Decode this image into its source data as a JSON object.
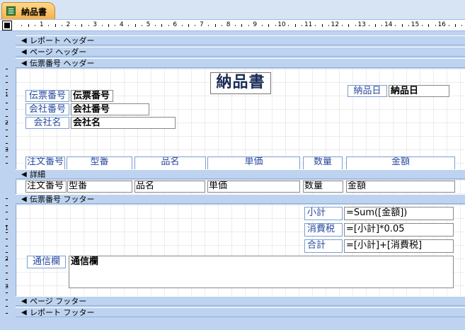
{
  "tab": {
    "label": "納品書",
    "icon": "report-icon"
  },
  "ruler": {
    "numbers": [
      "1",
      "2",
      "3",
      "4",
      "5",
      "6",
      "7",
      "8",
      "9",
      "10",
      "11",
      "12",
      "13",
      "14",
      "15",
      "16"
    ]
  },
  "gutter": {
    "page_header_numbers": [
      "1",
      "2",
      "3"
    ],
    "footer_numbers": [
      "1",
      "2",
      "3"
    ]
  },
  "sections": {
    "report_header": "レポート ヘッダー",
    "page_header": "ページ ヘッダー",
    "group_header": "伝票番号 ヘッダー",
    "detail": "詳細",
    "group_footer": "伝票番号 フッター",
    "page_footer": "ページ フッター",
    "report_footer": "レポート フッター"
  },
  "header": {
    "title": "納品書",
    "slip_no_label": "伝票番号",
    "slip_no_field": "伝票番号",
    "company_no_label": "会社番号",
    "company_no_field": "会社番号",
    "company_name_label": "会社名",
    "company_name_field": "会社名",
    "delivery_date_label": "納品日",
    "delivery_date_field": "納品日",
    "columns": [
      "注文番号",
      "型番",
      "品名",
      "単価",
      "数量",
      "金額"
    ]
  },
  "detail": {
    "fields": [
      "注文番号",
      "型番",
      "品名",
      "単価",
      "数量",
      "金額"
    ]
  },
  "footer": {
    "subtotal_label": "小計",
    "subtotal_expr": "=Sum([金額])",
    "tax_label": "消費税",
    "tax_expr": "=[小計]*0.05",
    "total_label": "合計",
    "total_expr": "=[小計]+[消費税]",
    "memo_label": "通信欄",
    "memo_field": "通信欄"
  }
}
